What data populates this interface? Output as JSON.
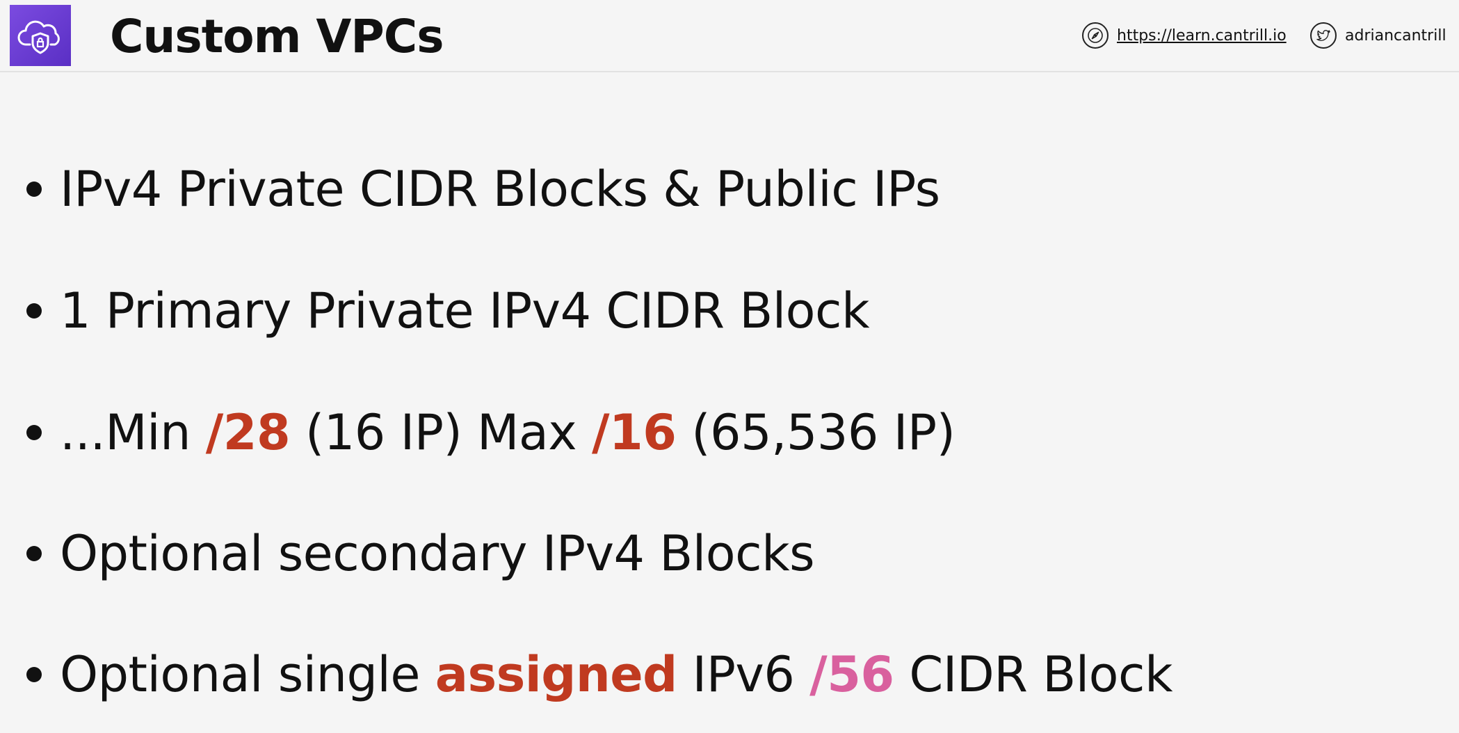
{
  "header": {
    "title": "Custom VPCs",
    "logo_icon": "cloud-shield-icon",
    "site_icon": "compass-icon",
    "site_url_text": "https://learn.cantrill.io",
    "twitter_icon": "twitter-bird-icon",
    "twitter_handle": "adriancantrill"
  },
  "colors": {
    "logo_background": "#6e3fd6",
    "highlight_red": "#c03a20",
    "highlight_pink": "#d9609e",
    "background": "#f5f5f5"
  },
  "bullets": [
    {
      "text": "IPv4 Private CIDR Blocks & Public IPs"
    },
    {
      "text": "1 Primary Private IPv4 CIDR Block"
    },
    {
      "parts": [
        "...Min ",
        "/28",
        " (16 IP) Max ",
        "/16",
        " (65,536 IP)"
      ]
    },
    {
      "text": "Optional secondary IPv4 Blocks"
    },
    {
      "parts": [
        "Optional single ",
        "assigned",
        " IPv6 ",
        "/56",
        " CIDR Block"
      ]
    }
  ]
}
